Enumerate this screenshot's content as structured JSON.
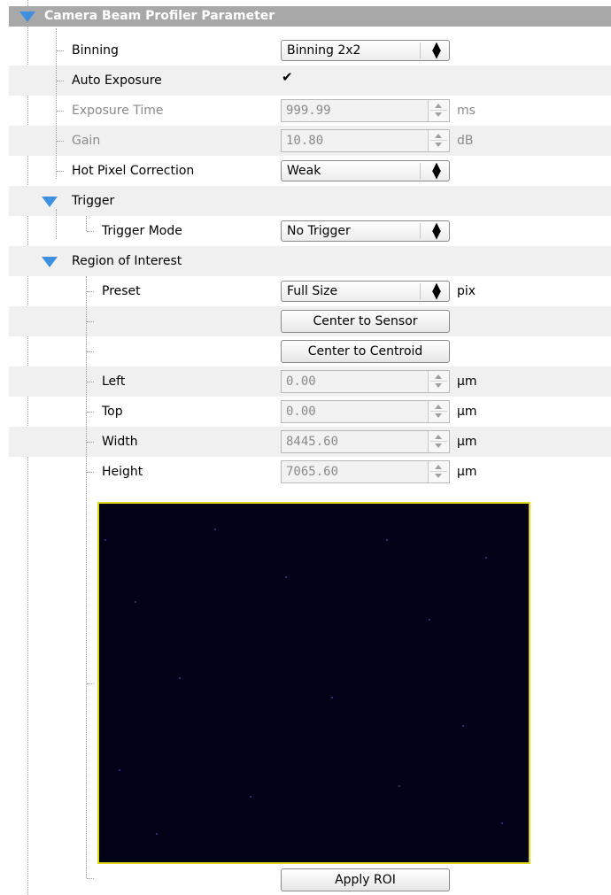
{
  "header": {
    "title": "Camera Beam Profiler Parameter"
  },
  "camera": {
    "binning": {
      "label": "Binning",
      "value": "Binning 2x2"
    },
    "auto_exposure": {
      "label": "Auto Exposure",
      "checked": true,
      "check_glyph": "✔"
    },
    "exposure_time": {
      "label": "Exposure Time",
      "value": "999.99",
      "unit": "ms"
    },
    "gain": {
      "label": "Gain",
      "value": "10.80",
      "unit": "dB"
    },
    "hot_pixel": {
      "label": "Hot Pixel Correction",
      "value": "Weak"
    }
  },
  "trigger": {
    "label": "Trigger",
    "mode": {
      "label": "Trigger Mode",
      "value": "No Trigger"
    }
  },
  "roi": {
    "label": "Region of Interest",
    "preset": {
      "label": "Preset",
      "value": "Full Size",
      "unit": "pix"
    },
    "center_sensor_label": "Center to Sensor",
    "center_centroid_label": "Center to Centroid",
    "left": {
      "label": "Left",
      "value": "0.00",
      "unit": "µm"
    },
    "top": {
      "label": "Top",
      "value": "0.00",
      "unit": "µm"
    },
    "width": {
      "label": "Width",
      "value": "8445.60",
      "unit": "µm"
    },
    "height": {
      "label": "Height",
      "value": "7065.60",
      "unit": "µm"
    },
    "apply_label": "Apply ROI"
  },
  "colors": {
    "header_bg": "#a8a8a8",
    "expand_arrow": "#3f8fe0",
    "preview_bg": "#020317",
    "preview_border": "#e1d617"
  },
  "icons": {
    "expand": "triangle-down-icon",
    "combo": "updown-arrows-icon",
    "spin": "spin-arrows-icon"
  }
}
